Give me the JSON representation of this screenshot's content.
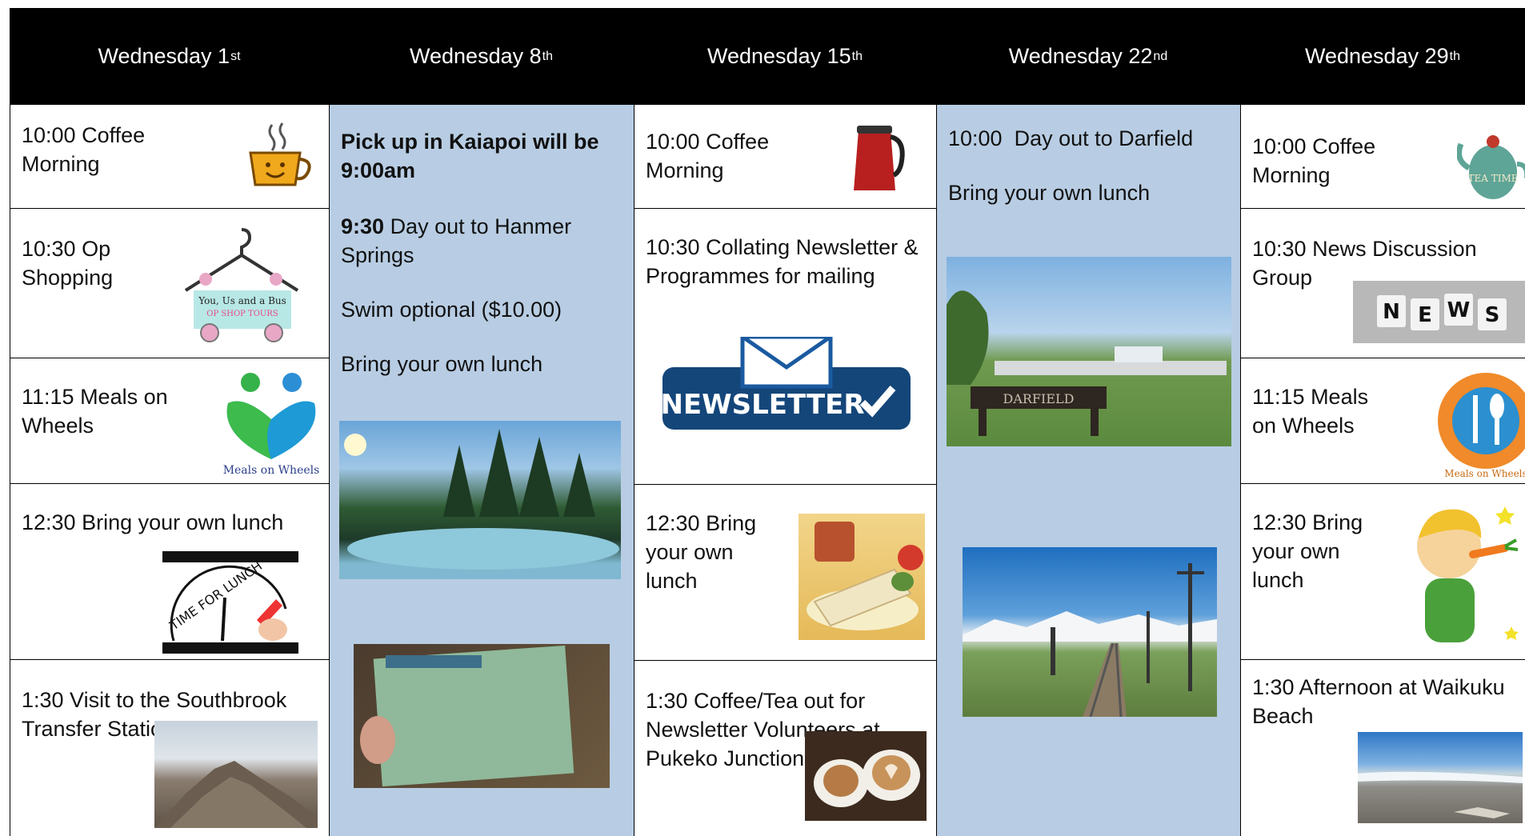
{
  "headers": [
    {
      "day": "Wednesday 1",
      "sup": "st"
    },
    {
      "day": "Wednesday 8",
      "sup": "th"
    },
    {
      "day": "Wednesday 15",
      "sup": "th"
    },
    {
      "day": "Wednesday 22",
      "sup": "nd"
    },
    {
      "day": "Wednesday 29",
      "sup": "th"
    }
  ],
  "col1": {
    "coffee": "10:00 Coffee Morning",
    "op_shopping": "10:30 Op Shopping",
    "op_logo_line1": "You, Us and a Bus",
    "op_logo_line2": "OP SHOP TOURS",
    "meals": "11:15 Meals on Wheels",
    "meals_logo": "Meals on Wheels",
    "lunch": "12:30 Bring your own lunch",
    "lunch_sign": "TIME FOR LUNCH",
    "visit": "1:30 Visit to the Southbrook Transfer Station"
  },
  "col2": {
    "pickup": "Pick up in Kaiapoi will be 9:00am",
    "time": "9:30",
    "dayout": "Day out to Hanmer Springs",
    "swim": "Swim optional ($10.00)",
    "lunch": "Bring your own lunch"
  },
  "col3": {
    "coffee": "10:00 Coffee Morning",
    "newsletter": "10:30 Collating Newsletter & Programmes for mailing",
    "newsletter_badge": "NEWSLETTER",
    "lunch": "12:30 Bring your own lunch",
    "coffee_tea": "1:30 Coffee/Tea out for Newsletter Volunteers at Pukeko Junction"
  },
  "col4": {
    "dayout": "10:00  Day out to Darfield",
    "lunch": "Bring your own lunch",
    "sign": "DARFIELD"
  },
  "col5": {
    "coffee": "10:00 Coffee Morning",
    "tea_label": "TEA TIME",
    "news": "10:30 News Discussion Group",
    "news_tiles": [
      "N",
      "E",
      "W",
      "S"
    ],
    "meals": "11:15 Meals on Wheels",
    "meals_logo": "Meals on Wheels",
    "lunch": "12:30 Bring your own lunch",
    "afternoon": "1:30 Afternoon at Waikuku Beach"
  }
}
